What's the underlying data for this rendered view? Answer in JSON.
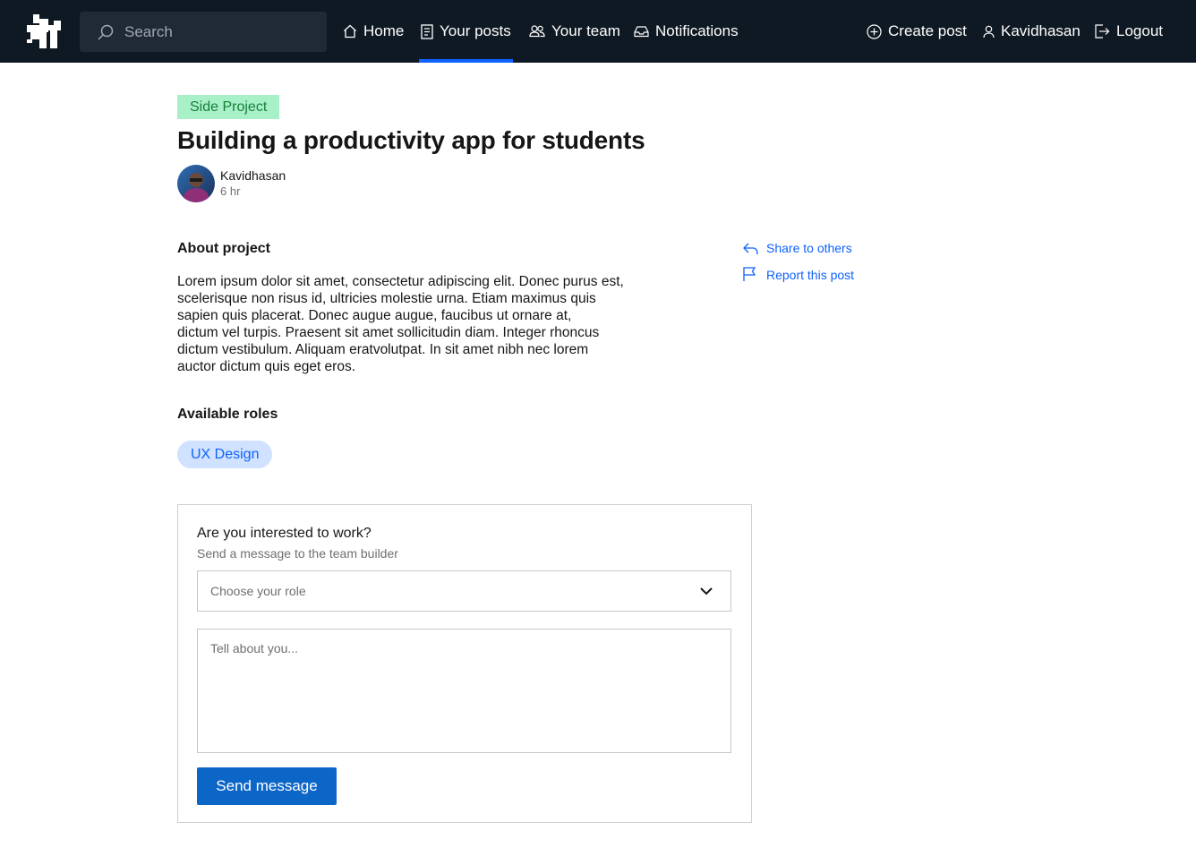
{
  "navbar": {
    "search_placeholder": "Search",
    "items": [
      {
        "label": "Home",
        "icon": "home-icon"
      },
      {
        "label": "Your posts",
        "icon": "document-icon",
        "active": true
      },
      {
        "label": "Your team",
        "icon": "team-icon"
      },
      {
        "label": "Notifications",
        "icon": "inbox-icon"
      }
    ],
    "right": [
      {
        "label": "Create post",
        "icon": "add-circle-icon"
      },
      {
        "label": "Kavidhasan",
        "icon": "user-icon"
      },
      {
        "label": "Logout",
        "icon": "logout-icon"
      }
    ]
  },
  "post": {
    "tag": "Side Project",
    "title": "Building a productivity app for students",
    "author": "Kavidhasan",
    "time": "6 hr",
    "about_heading": "About project",
    "about_lines": [
      "Lorem ipsum dolor sit amet, consectetur adipiscing elit. Donec purus est,",
      "scelerisque non risus id, ultricies  molestie urna. Etiam maximus quis",
      "sapien quis placerat. Donec augue augue, faucibus ut ornare at,",
      "dictum vel turpis. Praesent sit amet sollicitudin diam. Integer rhoncus",
      "dictum vestibulum. Aliquam eratvolutpat. In sit amet nibh nec lorem",
      "auctor dictum quis eget eros."
    ],
    "roles_heading": "Available roles",
    "roles": [
      "UX Design"
    ]
  },
  "side_actions": {
    "share": "Share to others",
    "report": "Report this post"
  },
  "apply_card": {
    "title": "Are you interested to work?",
    "subtitle": "Send a message to the team builder",
    "role_select_placeholder": "Choose your role",
    "message_placeholder": "Tell about you...",
    "send_label": "Send message"
  },
  "colors": {
    "navbar_bg": "#0f1923",
    "accent": "#0f62fe",
    "tag_bg": "#a7f0c8",
    "tag_text": "#198038",
    "pill_bg": "#d0e2ff",
    "button_bg": "#0c66c7"
  }
}
